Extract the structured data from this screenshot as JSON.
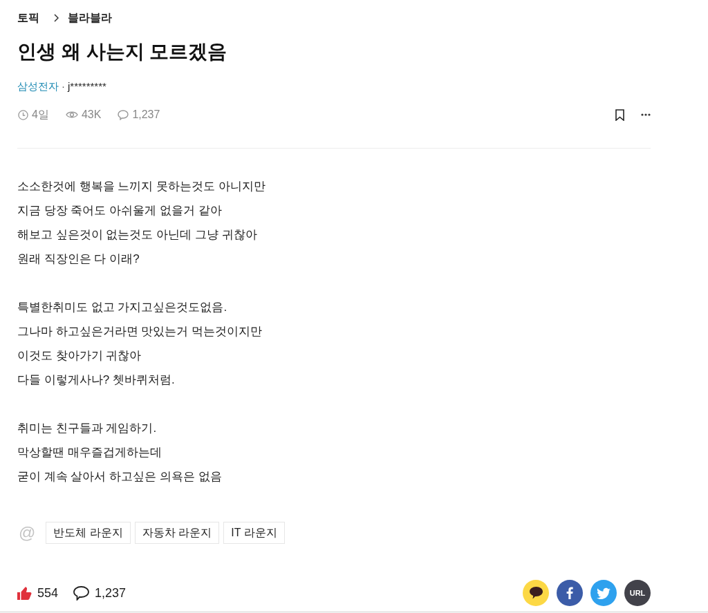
{
  "breadcrumb": [
    {
      "label": "토픽"
    },
    {
      "label": "블라블라"
    }
  ],
  "post": {
    "title": "인생 왜 사는지 모르겠음",
    "company": "삼성전자",
    "separator": "·",
    "author": "j*********"
  },
  "meta": [
    {
      "kind": "time",
      "text": "4일"
    },
    {
      "kind": "views",
      "text": "43K"
    },
    {
      "kind": "comments",
      "text": "1,237"
    }
  ],
  "actions": {
    "bookmarked": false
  },
  "body": {
    "paragraphs": [
      [
        "소소한것에 행복을 느끼지 못하는것도 아니지만",
        "지금 당장 죽어도 아쉬울게 없을거 같아",
        "해보고 싶은것이 없는것도 아닌데 그냥 귀찮아",
        "원래 직장인은 다 이래?"
      ],
      [
        "특별한취미도 없고 가지고싶은것도없음.",
        "그나마 하고싶은거라면 맛있는거 먹는것이지만",
        "이것도 찾아가기 귀찮아",
        "다들 이렇게사나? 쳇바퀴처럼."
      ],
      [
        "취미는 친구들과 게임하기.",
        "막상할땐 매우즐겁게하는데",
        "굳이 계속 살아서 하고싶은 의욕은 없음"
      ]
    ]
  },
  "lounges": {
    "symbol": "@",
    "tags": [
      "반도체 라운지",
      "자동차 라운지",
      "IT 라운지"
    ]
  },
  "footer": {
    "likes": "554",
    "comments": "1,237"
  },
  "share": [
    {
      "kind": "chat",
      "color": "#fcd845"
    },
    {
      "kind": "facebook",
      "color": "#3b5ca8"
    },
    {
      "kind": "twitter",
      "color": "#2ea1ee"
    },
    {
      "kind": "url",
      "color": "#42424a",
      "label": "URL"
    }
  ]
}
